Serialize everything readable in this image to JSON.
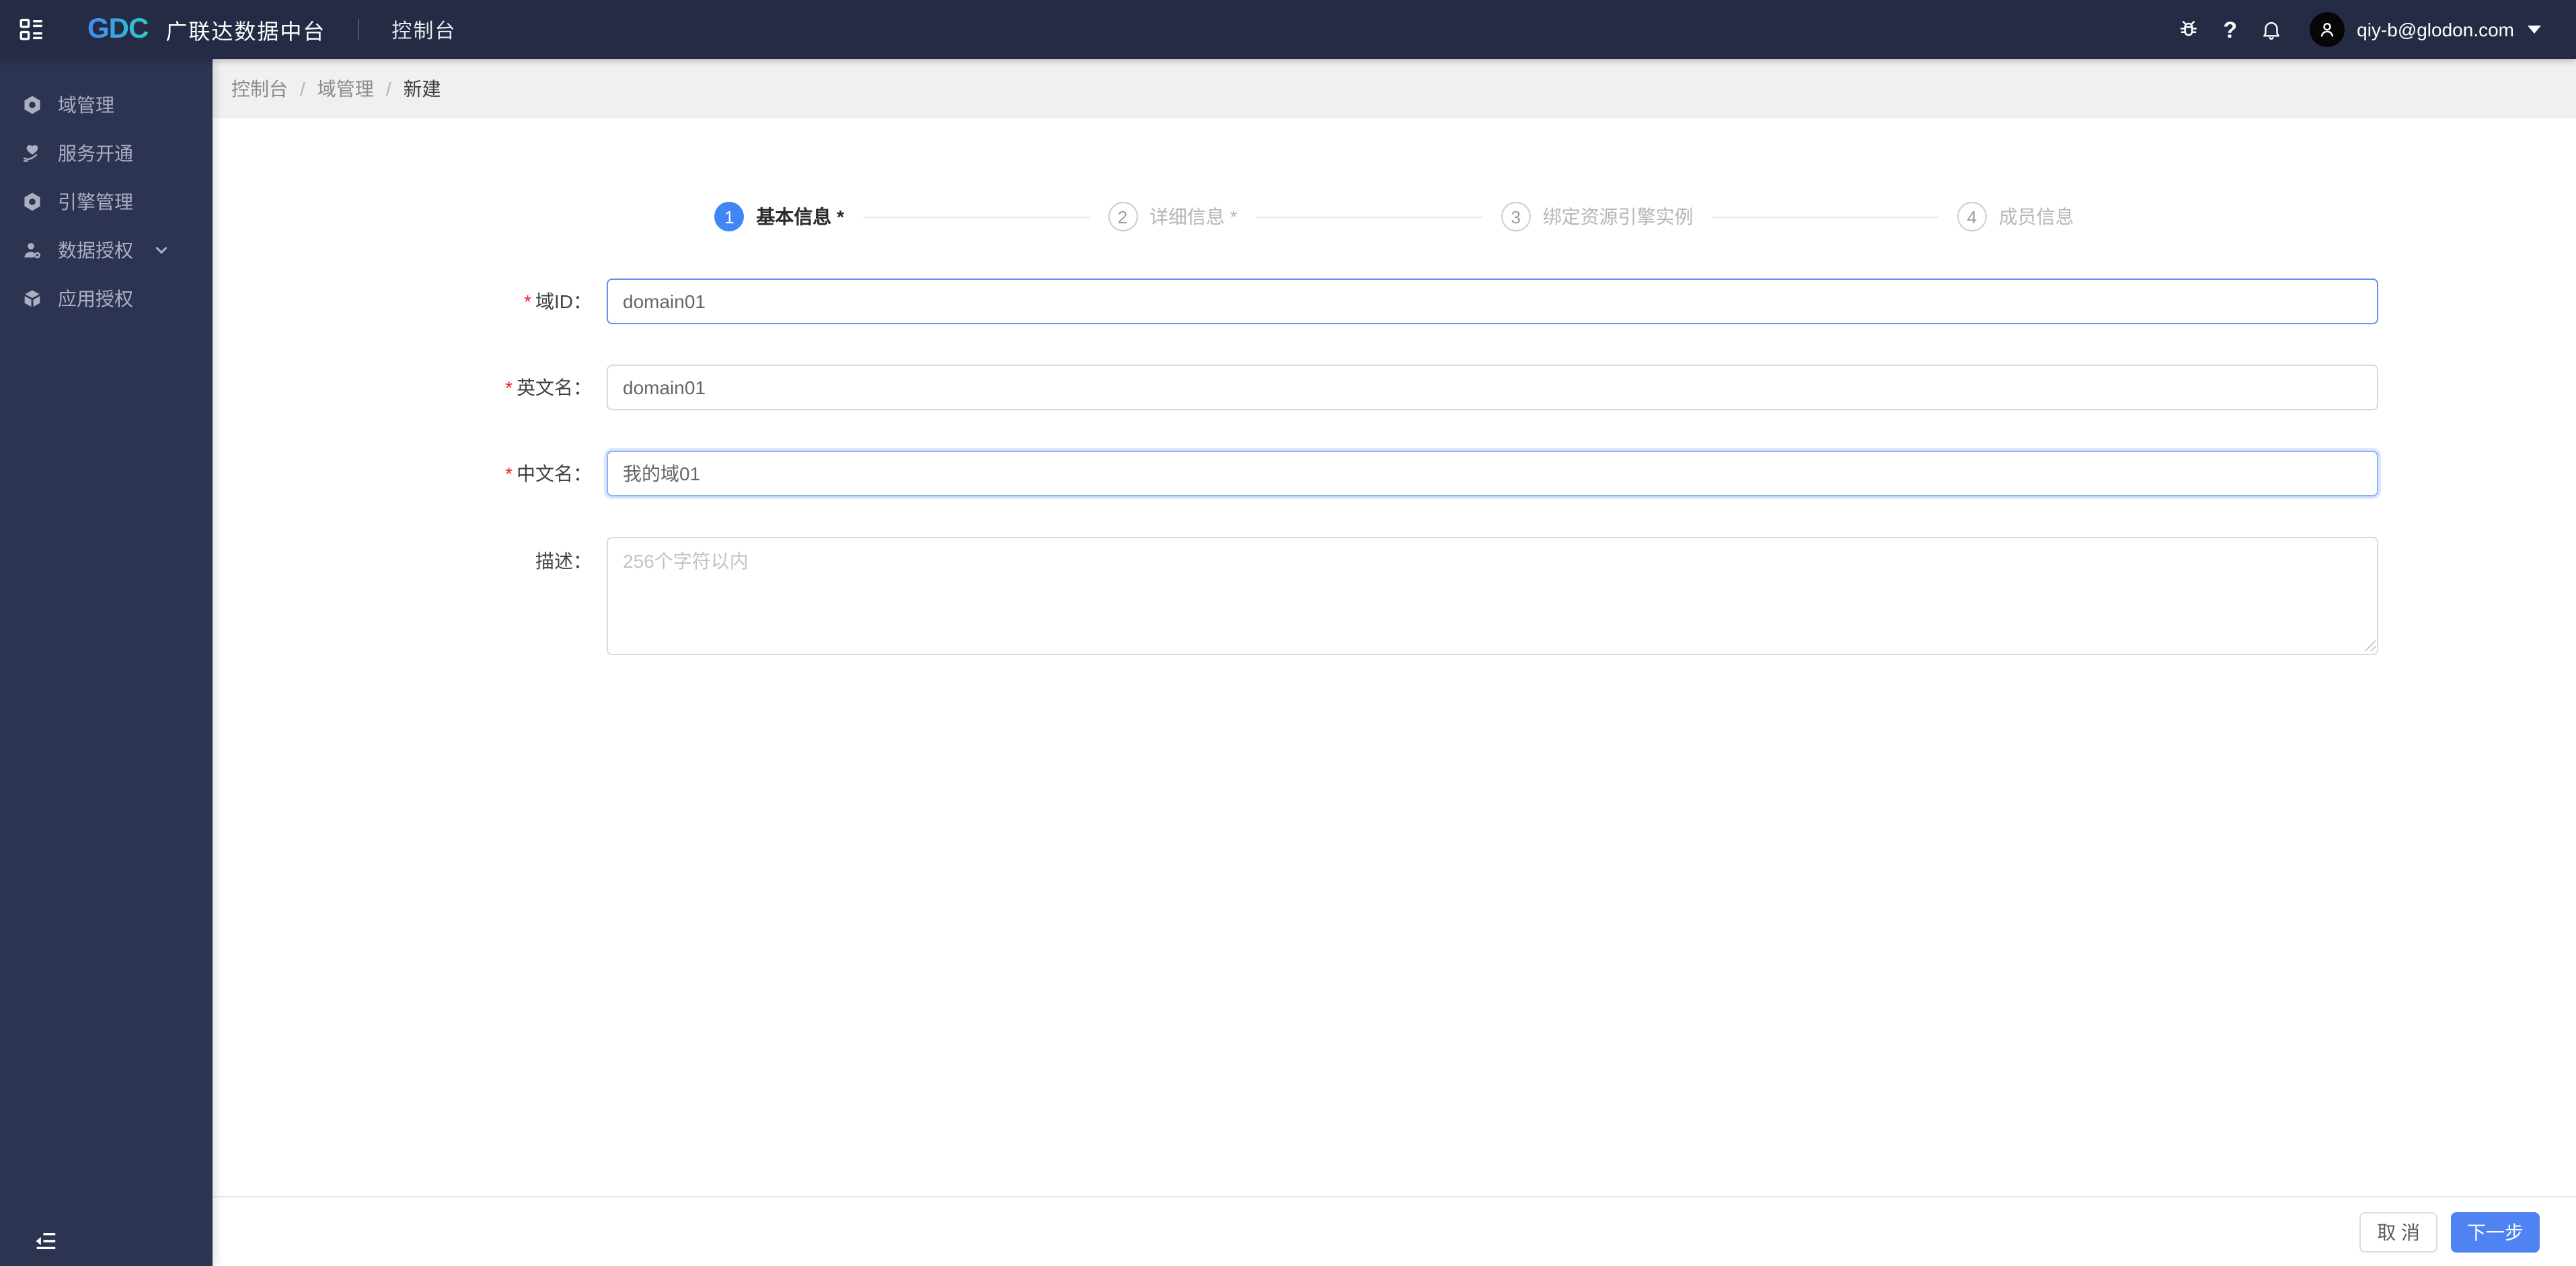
{
  "header": {
    "logo_text": "GDC",
    "product_name": "广联达数据中台",
    "console_label": "控制台",
    "user_email": "qiy-b@glodon.com"
  },
  "icons": {
    "help_glyph": "?"
  },
  "sidebar": {
    "items": [
      {
        "label": "域管理",
        "icon": "hexagon-nut-icon"
      },
      {
        "label": "服务开通",
        "icon": "hand-heart-icon"
      },
      {
        "label": "引擎管理",
        "icon": "hexagon-nut-icon"
      },
      {
        "label": "数据授权",
        "icon": "user-gear-icon",
        "expandable": true
      },
      {
        "label": "应用授权",
        "icon": "cube-icon"
      }
    ]
  },
  "breadcrumb": {
    "separator": "/",
    "items": [
      "控制台",
      "域管理",
      "新建"
    ]
  },
  "stepper": {
    "steps": [
      {
        "num": "1",
        "label": "基本信息 *",
        "state": "active"
      },
      {
        "num": "2",
        "label": "详细信息 *",
        "state": "pending"
      },
      {
        "num": "3",
        "label": "绑定资源引擎实例",
        "state": "pending"
      },
      {
        "num": "4",
        "label": "成员信息",
        "state": "pending"
      }
    ]
  },
  "form": {
    "required_marker": "*",
    "fields": [
      {
        "label": "域ID：",
        "value": "domain01",
        "required": true,
        "focused": true
      },
      {
        "label": "英文名：",
        "value": "domain01",
        "required": true,
        "focused": false
      },
      {
        "label": "中文名：",
        "value": "我的域01",
        "required": true,
        "focused": true
      },
      {
        "label": "描述：",
        "placeholder": "256个字符以内",
        "required": false,
        "type": "textarea"
      }
    ]
  },
  "footer": {
    "cancel_label": "取 消",
    "next_label": "下一步"
  },
  "colors": {
    "accent_blue": "#4186f5",
    "button_blue": "#4e83f1",
    "header_bg": "#252b45",
    "sidebar_bg": "#2d3452",
    "required_red": "#f5222d"
  }
}
